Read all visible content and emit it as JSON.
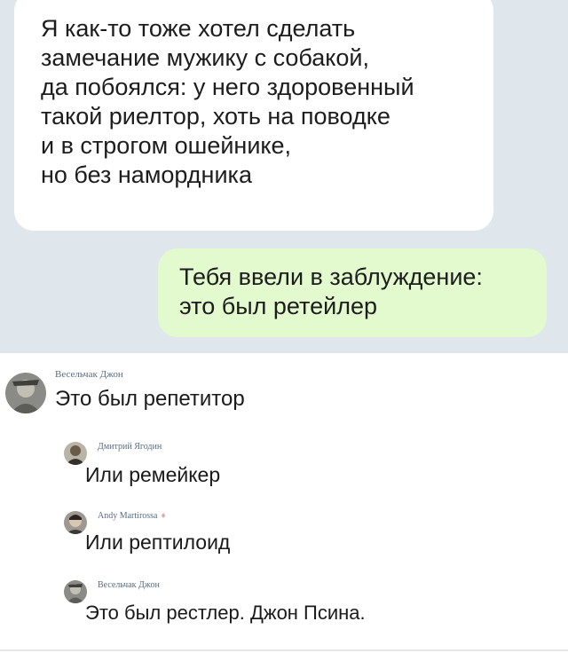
{
  "chat": {
    "incoming_lines": [
      "Я как-то тоже хотел сделать",
      "замечание мужику с собакой,",
      "да побоялся: у него здоровенный",
      "такой риелтор, хоть на поводке",
      "и в строгом ошейнике,",
      "но без намордника"
    ],
    "outgoing_lines": [
      "Тебя ввели в заблуждение:",
      "это был ретейлер"
    ]
  },
  "comments": [
    {
      "author": "Весельчак Джон",
      "text": "Это был репетитор"
    },
    {
      "author": "Дмитрий Ягодин",
      "text": "Или ремейкер"
    },
    {
      "author": "Andy Martirossa",
      "badge": "♦",
      "text": "Или рептилоид"
    },
    {
      "author": "Весельчак Джон",
      "text": "Это был рестлер. Джон Псина."
    }
  ],
  "colors": {
    "chat_background": "#dfe6ec",
    "incoming_bubble": "#ffffff",
    "outgoing_bubble": "#e3f9ce",
    "author_name": "#5a6d80"
  }
}
